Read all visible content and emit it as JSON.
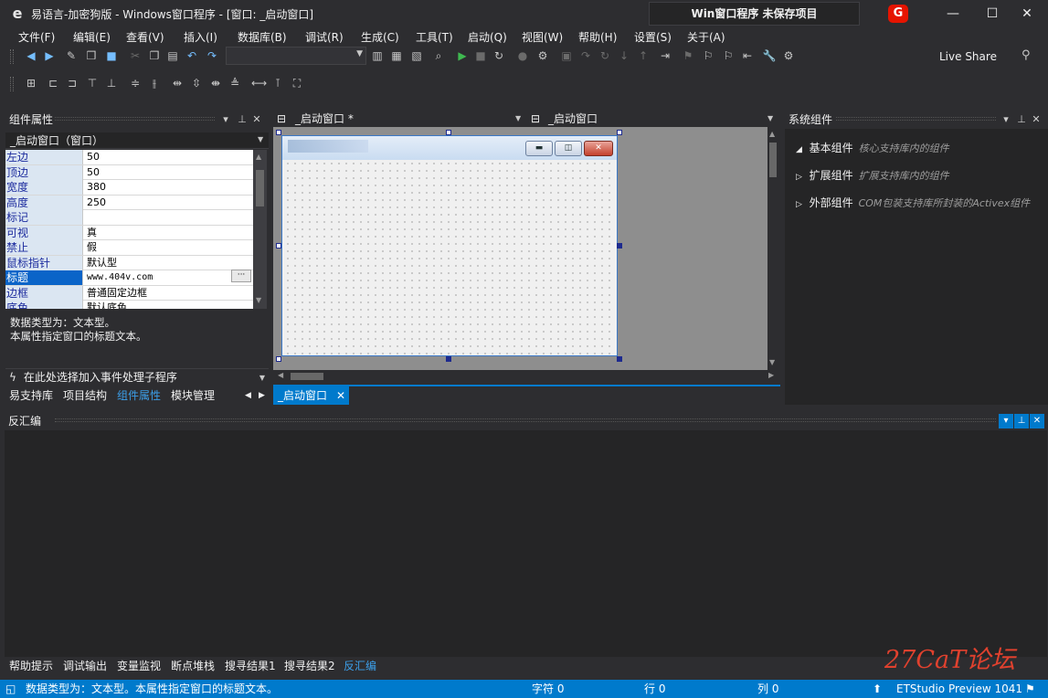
{
  "titlebar": {
    "title": "易语言-加密狗版 - Windows窗口程序 - [窗口: _启动窗口]",
    "project": "Win窗口程序  未保存项目",
    "badge": "G",
    "minimize": "—",
    "maximize": "☐",
    "close": "✕"
  },
  "menu": [
    "文件(F)",
    "编辑(E)",
    "查看(V)",
    "插入(I)",
    "数据库(B)",
    "调试(R)",
    "生成(C)",
    "工具(T)",
    "启动(Q)",
    "视图(W)",
    "帮助(H)",
    "设置(S)",
    "关于(A)"
  ],
  "toolbar": {
    "live_share": "Live Share"
  },
  "left_panel": {
    "title": "组件属性",
    "object": "_启动窗口（窗口）",
    "properties": [
      {
        "name": "左边",
        "value": "50"
      },
      {
        "name": "顶边",
        "value": "50"
      },
      {
        "name": "宽度",
        "value": "380"
      },
      {
        "name": "高度",
        "value": "250"
      },
      {
        "name": "标记",
        "value": ""
      },
      {
        "name": "可视",
        "value": "真"
      },
      {
        "name": "禁止",
        "value": "假"
      },
      {
        "name": "鼠标指针",
        "value": "默认型"
      },
      {
        "name": "标题",
        "value": "www.404v.com"
      },
      {
        "name": "边框",
        "value": "普通固定边框"
      },
      {
        "name": "底色",
        "value": "默认底色"
      }
    ],
    "description": [
      "数据类型为：文本型。",
      "本属性指定窗口的标题文本。"
    ],
    "event_hint": "在此处选择加入事件处理子程序",
    "tabs": [
      "易支持库",
      "项目结构",
      "组件属性",
      "模块管理"
    ],
    "active_tab": "组件属性"
  },
  "editor": {
    "tab1": "_启动窗口 *",
    "tab2": "_启动窗口",
    "bottom_tab": "_启动窗口"
  },
  "right_panel": {
    "title": "系统组件",
    "items": [
      {
        "label": "基本组件",
        "desc": "核心支持库内的组件",
        "expanded": true
      },
      {
        "label": "扩展组件",
        "desc": "扩展支持库内的组件",
        "expanded": false
      },
      {
        "label": "外部组件",
        "desc": "COM包装支持库所封装的Activex组件",
        "expanded": false
      }
    ]
  },
  "output_panel": {
    "title": "反汇编",
    "tabs": [
      "帮助提示",
      "调试输出",
      "变量监视",
      "断点堆栈",
      "搜寻结果1",
      "搜寻结果2",
      "反汇编"
    ],
    "active_tab": "反汇编"
  },
  "statusbar": {
    "message": "数据类型为：文本型。本属性指定窗口的标题文本。",
    "chars": "字符 0",
    "row": "行 0",
    "col": "列 0",
    "version": "ETStudio Preview 1041"
  },
  "watermark": "27CaT论坛",
  "colors": {
    "accent": "#007acc",
    "background": "#2d2d30",
    "selection": "#0a64c8"
  }
}
